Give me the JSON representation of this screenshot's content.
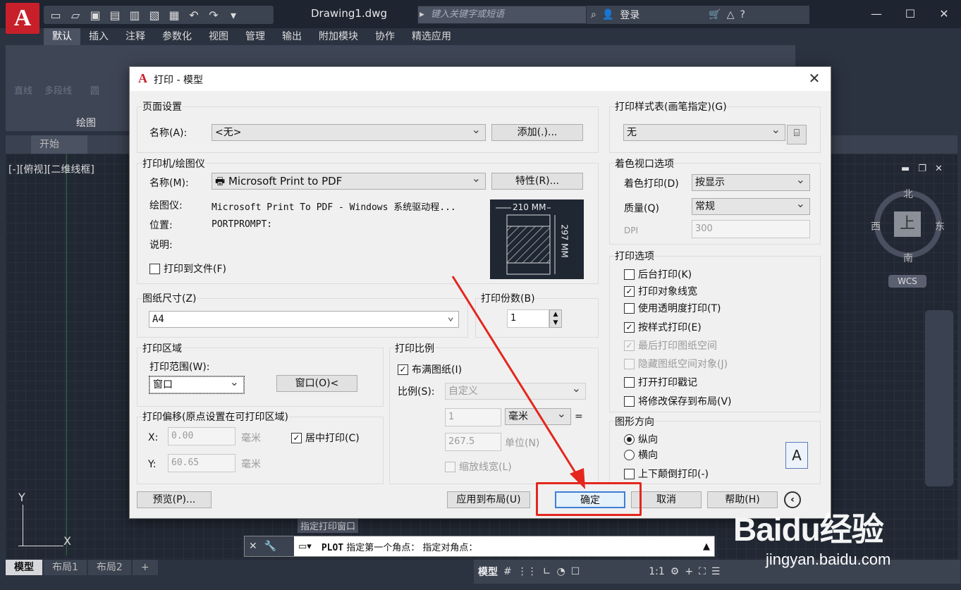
{
  "app": {
    "logo_letter": "A",
    "document_title": "Drawing1.dwg",
    "search_placeholder": "键入关键字或短语",
    "login_label": "登录",
    "ribbon_tabs": [
      "默认",
      "插入",
      "注释",
      "参数化",
      "视图",
      "管理",
      "输出",
      "附加模块",
      "协作",
      "精选应用"
    ],
    "ribbon_tools": [
      "直线",
      "多段线",
      "圆",
      "圆"
    ],
    "draw_panel_label": "绘图",
    "start_tab": "开始",
    "view_label": "[-][俯视][二维线框]",
    "compass": {
      "north": "北",
      "south": "南",
      "west": "西",
      "east": "东",
      "top": "上"
    },
    "wcs_label": "WCS",
    "ucs_x": "X",
    "ucs_y": "Y"
  },
  "command_line": {
    "command": "PLOT",
    "text": "指定第一个角点： 指定对角点：",
    "tooltip": "指定打印窗口"
  },
  "status_bar": {
    "layout_tabs": [
      "模型",
      "布局1",
      "布局2"
    ],
    "model_label": "模型",
    "scale_label": "1:1"
  },
  "dialog": {
    "title": "打印 - 模型",
    "page_setup": {
      "group_label": "页面设置",
      "name_label": "名称(A):",
      "name_value": "<无>",
      "add_button": "添加(.)..."
    },
    "printer": {
      "group_label": "打印机/绘图仪",
      "name_label": "名称(M):",
      "name_value": "Microsoft Print to PDF",
      "properties_button": "特性(R)...",
      "plotter_label": "绘图仪:",
      "plotter_value": "Microsoft Print To PDF - Windows 系统驱动程...",
      "location_label": "位置:",
      "location_value": "PORTPROMPT:",
      "description_label": "说明:",
      "print_to_file": "打印到文件(F)",
      "preview_width": "210 MM",
      "preview_height": "297 MM"
    },
    "paper_size": {
      "group_label": "图纸尺寸(Z)",
      "value": "A4"
    },
    "copies": {
      "group_label": "打印份数(B)",
      "value": "1"
    },
    "plot_area": {
      "group_label": "打印区域",
      "range_label": "打印范围(W):",
      "range_value": "窗口",
      "window_button": "窗口(O)<"
    },
    "plot_offset": {
      "group_label": "打印偏移(原点设置在可打印区域)",
      "x_label": "X:",
      "x_value": "0.00",
      "y_label": "Y:",
      "y_value": "60.65",
      "unit": "毫米",
      "center_plot": "居中打印(C)"
    },
    "plot_scale": {
      "group_label": "打印比例",
      "fit_to_paper": "布满图纸(I)",
      "scale_label": "比例(S):",
      "scale_value": "自定义",
      "value1": "1",
      "unit1": "毫米",
      "equals": "=",
      "value2": "267.5",
      "unit2": "单位(N)",
      "scale_lineweights": "缩放线宽(L)"
    },
    "plot_style_table": {
      "group_label": "打印样式表(画笔指定)(G)",
      "value": "无"
    },
    "shaded_viewport": {
      "group_label": "着色视口选项",
      "shade_label": "着色打印(D)",
      "shade_value": "按显示",
      "quality_label": "质量(Q)",
      "quality_value": "常规",
      "dpi_label": "DPI",
      "dpi_value": "300"
    },
    "plot_options": {
      "group_label": "打印选项",
      "items": [
        {
          "label": "后台打印(K)",
          "checked": false,
          "disabled": false
        },
        {
          "label": "打印对象线宽",
          "checked": true,
          "disabled": false
        },
        {
          "label": "使用透明度打印(T)",
          "checked": false,
          "disabled": false
        },
        {
          "label": "按样式打印(E)",
          "checked": true,
          "disabled": false
        },
        {
          "label": "最后打印图纸空间",
          "checked": true,
          "disabled": true
        },
        {
          "label": "隐藏图纸空间对象(J)",
          "checked": false,
          "disabled": true
        },
        {
          "label": "打开打印戳记",
          "checked": false,
          "disabled": false
        },
        {
          "label": "将修改保存到布局(V)",
          "checked": false,
          "disabled": false
        }
      ]
    },
    "drawing_orientation": {
      "group_label": "图形方向",
      "portrait": "纵向",
      "landscape": "横向",
      "upside_down": "上下颠倒打印(-)",
      "selected": "portrait"
    },
    "buttons": {
      "preview": "预览(P)...",
      "apply_to_layout": "应用到布局(U)",
      "ok": "确定",
      "cancel": "取消",
      "help": "帮助(H)"
    }
  },
  "watermark": {
    "brand": "Baidu经验",
    "url": "jingyan.baidu.com"
  },
  "colors": {
    "annotation_red": "#e4261d",
    "logo_red": "#c8202a",
    "focus_blue": "#3c7fd6"
  }
}
